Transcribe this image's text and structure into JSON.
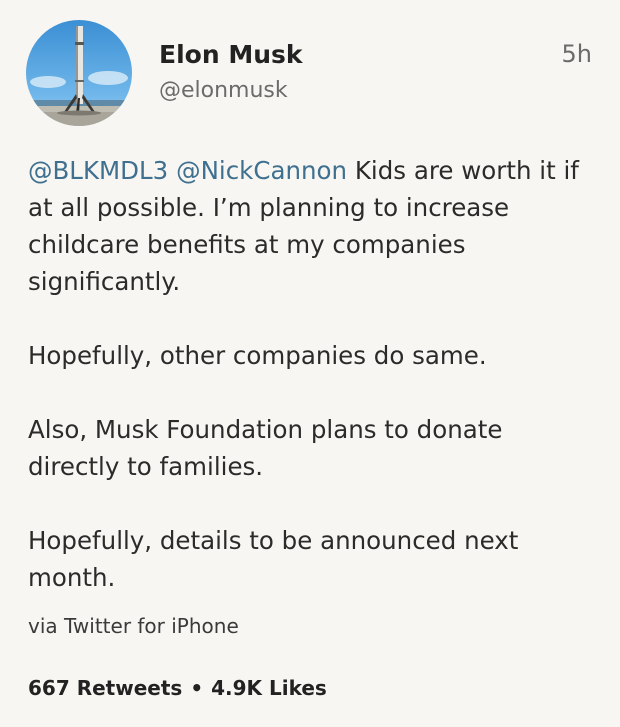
{
  "author": {
    "name": "Elon Musk",
    "handle": "@elonmusk",
    "avatar_icon": "rocket-launchpad-avatar"
  },
  "timestamp": "5h",
  "tweet": {
    "mention_1": "@BLKMDL3",
    "mention_2": "@NickCannon",
    "paragraph_1_rest": " Kids are worth it if at all possible. I’m planning to increase childcare benefits at my companies significantly.",
    "paragraph_2": "Hopefully, other companies do same.",
    "paragraph_3": "Also, Musk Foundation plans to donate directly to families.",
    "paragraph_4": "Hopefully, details to be announced next month."
  },
  "source": "via Twitter for iPhone",
  "stats": {
    "retweets": "667 Retweets",
    "separator": "•",
    "likes": "4.9K Likes"
  },
  "colors": {
    "background": "#f7f6f2",
    "mention": "#3f7090",
    "text": "#2b2b2b",
    "muted": "#6b6b6b"
  }
}
